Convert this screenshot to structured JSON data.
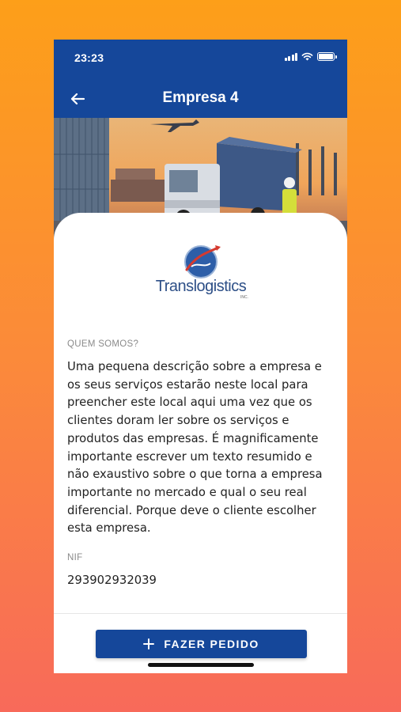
{
  "status_bar": {
    "time": "23:23",
    "icons": [
      "signal-icon",
      "wifi-icon",
      "battery-icon"
    ]
  },
  "header": {
    "title": "Empresa 4",
    "back_icon": "arrow-left-icon"
  },
  "hero": {
    "image_subject": "cargo-logistics-photo"
  },
  "company": {
    "logo_text": "Translogistics",
    "logo_suffix": "INC.",
    "about_label": "QUEM SOMOS?",
    "about_text": "Uma pequena descrição sobre a empresa e os seus serviços estarão neste local para preencher este local aqui uma vez que os clientes doram ler sobre os serviços e produtos das empresas. É magnificamente importante escrever um texto resumido e não exaustivo sobre o que torna a empresa importante no mercado e qual o seu real diferencial. Porque deve o cliente escolher esta empresa.",
    "nif_label": "NIF",
    "nif_value": "293902932039"
  },
  "action": {
    "button_label": "FAZER PEDIDO",
    "button_icon": "plus-icon"
  },
  "colors": {
    "primary": "#15479a",
    "background_top": "#fd9f19",
    "background_bottom": "#f86a5a"
  }
}
